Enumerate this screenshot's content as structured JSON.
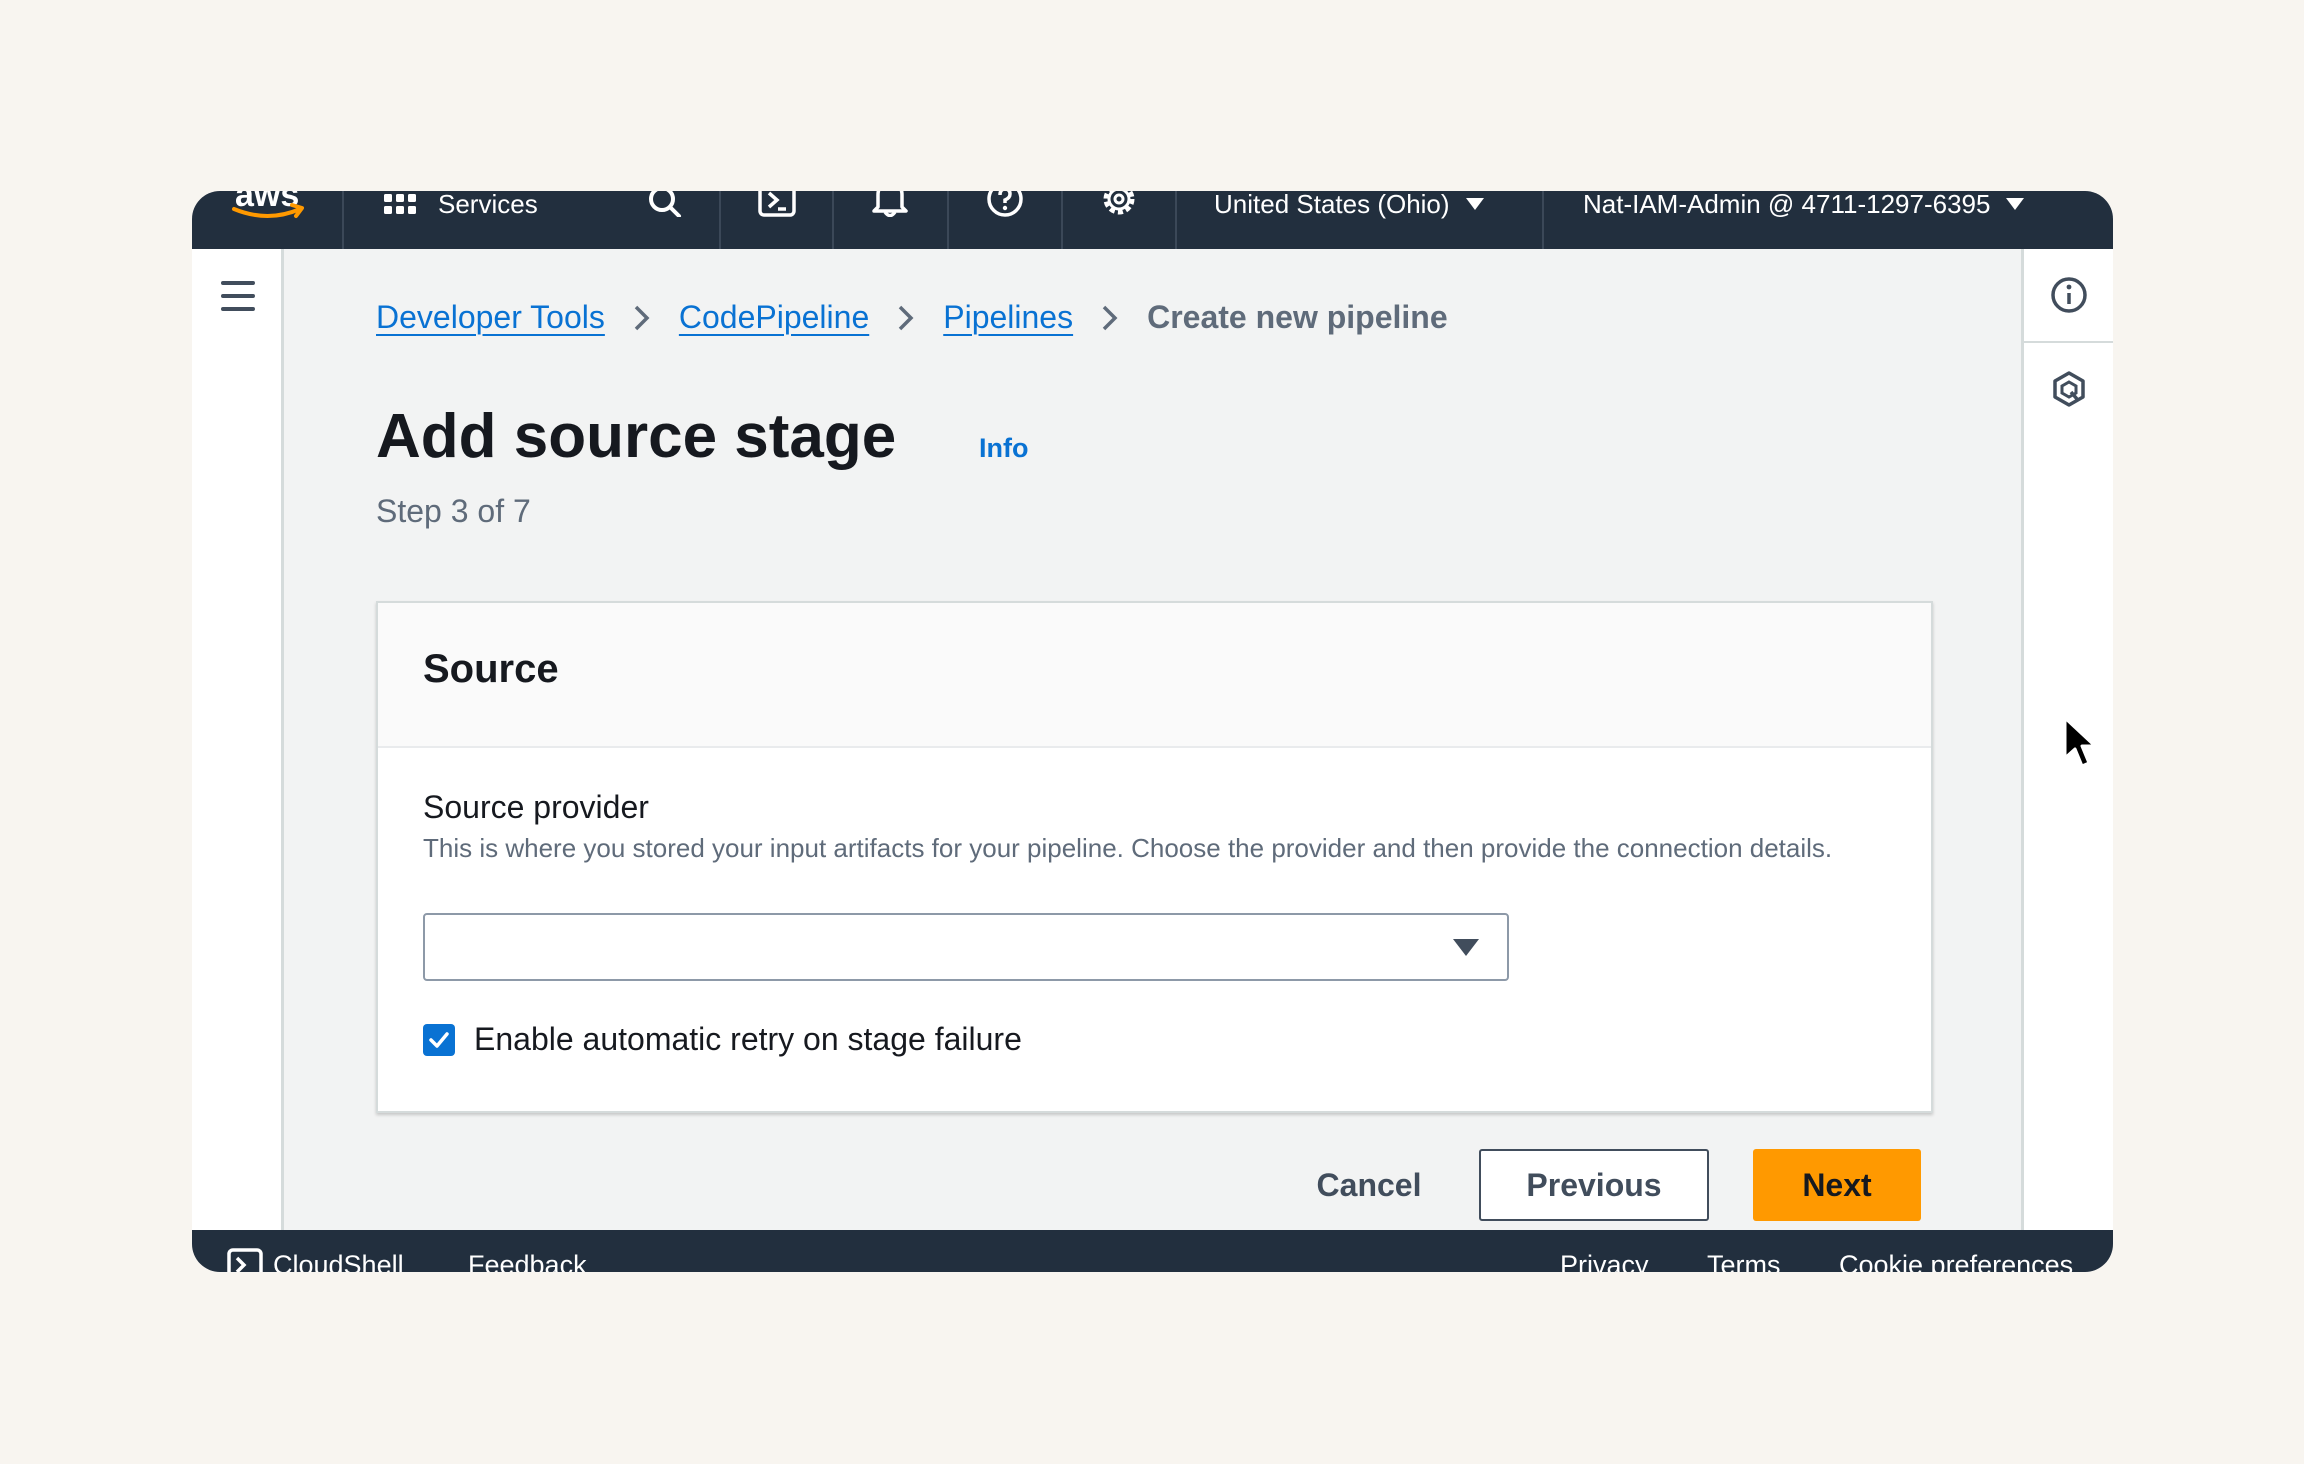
{
  "topbar": {
    "logo_text": "aws",
    "services_label": "Services",
    "region_label": "United States (Ohio)",
    "account_label": "Nat-IAM-Admin @ 4711-1297-6395",
    "icons": [
      "grid-icon",
      "search-icon",
      "cloudshell-icon",
      "bell-icon",
      "help-icon",
      "settings-icon"
    ]
  },
  "breadcrumb": {
    "items": [
      "Developer Tools",
      "CodePipeline",
      "Pipelines"
    ],
    "current": "Create new pipeline"
  },
  "page": {
    "title": "Add source stage",
    "info_link": "Info",
    "step": "Step 3 of 7"
  },
  "source_card": {
    "title": "Source",
    "provider_label": "Source provider",
    "provider_description": "This is where you stored your input artifacts for your pipeline. Choose the provider and then provide the connection details.",
    "provider_value": "",
    "retry_label": "Enable automatic retry on stage failure",
    "retry_checked": true
  },
  "actions": {
    "cancel": "Cancel",
    "previous": "Previous",
    "next": "Next"
  },
  "footer": {
    "cloudshell": "CloudShell",
    "feedback": "Feedback",
    "privacy": "Privacy",
    "terms": "Terms",
    "cookie": "Cookie preferences"
  },
  "colors": {
    "nav_bg": "#222f3e",
    "link": "#0972d3",
    "primary_button": "#ff9900",
    "page_bg": "#f2f3f3"
  }
}
